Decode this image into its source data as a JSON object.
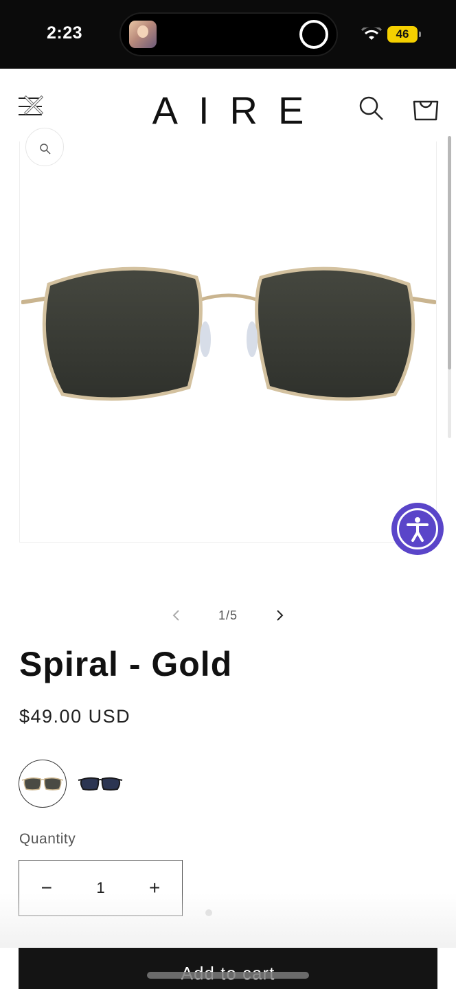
{
  "status_bar": {
    "time": "2:23",
    "battery": "46"
  },
  "header": {
    "logo": "AIRE"
  },
  "gallery": {
    "counter": "1/5"
  },
  "product": {
    "title": "Spiral - Gold",
    "price": "$49.00 USD",
    "swatches": [
      {
        "name": "Gold / Smoke",
        "selected": true
      },
      {
        "name": "Black / Blue",
        "selected": false
      }
    ],
    "quantity_label": "Quantity",
    "quantity_value": "1",
    "minus_symbol": "−",
    "plus_symbol": "+",
    "add_to_cart_label": "Add to cart"
  },
  "colors": {
    "accessibility_button": "#5a45c9",
    "battery": "#f5d000",
    "primary_button": "#141414"
  },
  "icons": [
    "menu-icon",
    "close-icon",
    "search-icon",
    "cart-icon",
    "zoom-icon",
    "chevron-left-icon",
    "chevron-right-icon",
    "accessibility-icon",
    "wifi-icon"
  ]
}
